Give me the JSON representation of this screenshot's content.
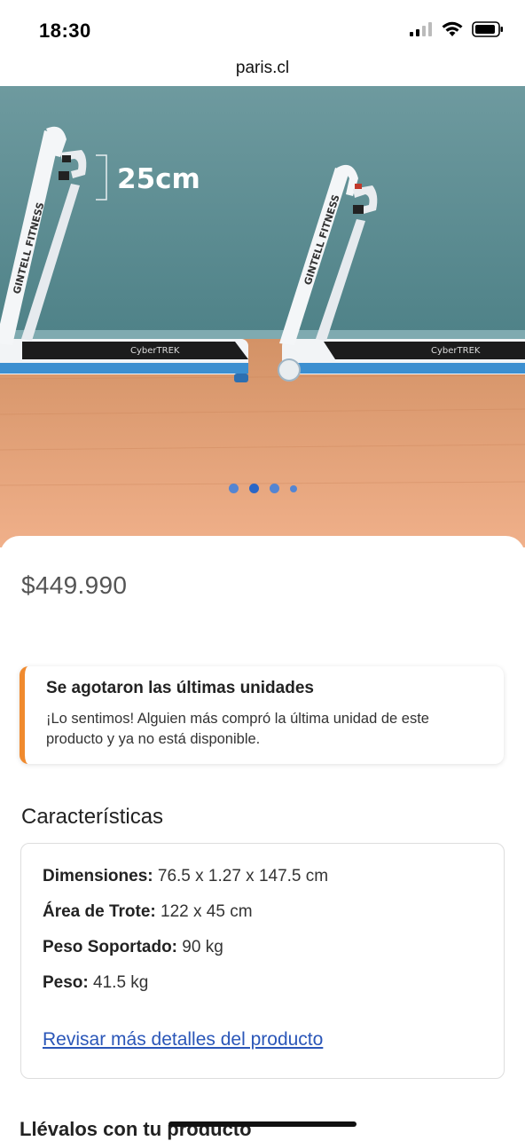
{
  "status_bar": {
    "time": "18:30"
  },
  "browser": {
    "url": "paris.cl"
  },
  "gallery": {
    "height_annotation": "25cm",
    "brand_left": "GINTELL FITNESS",
    "brand_right": "GINTELL FITNESS",
    "deck_label_left": "CyberTREK",
    "deck_label_right": "CyberTREK",
    "slide_count": 4,
    "active_slide": 2
  },
  "product": {
    "price": "$449.990"
  },
  "alert": {
    "title": "Se agotaron las últimas unidades",
    "body": "¡Lo sentimos! Alguien más compró la última unidad de este producto y ya no está disponible.",
    "accent_color": "#f08a2e"
  },
  "features": {
    "title": "Características",
    "items": [
      {
        "label": "Dimensiones:",
        "value": " 76.5 x 1.27 x 147.5 cm"
      },
      {
        "label": "Área de Trote:",
        "value": " 122 x 45 cm"
      },
      {
        "label": "Peso Soportado:",
        "value": " 90 kg"
      },
      {
        "label": "Peso:",
        "value": " 41.5 kg"
      }
    ],
    "details_link": "Revisar más detalles del producto",
    "link_color": "#2a56b8"
  },
  "next_section": {
    "title_partial": "Llévalos con tu producto"
  }
}
